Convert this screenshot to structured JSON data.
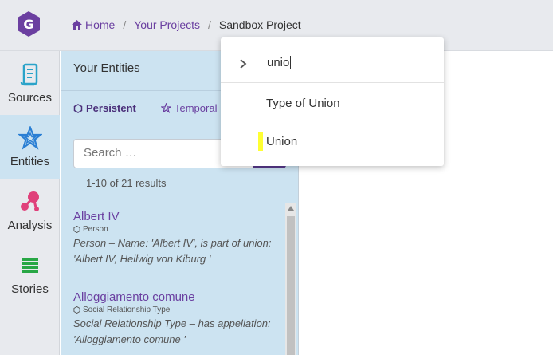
{
  "breadcrumb": {
    "home": "Home",
    "projects": "Your Projects",
    "current": "Sandbox Project"
  },
  "nav": [
    {
      "label": "Sources",
      "icon": "scroll-icon"
    },
    {
      "label": "Entities",
      "icon": "star-icon",
      "active": true
    },
    {
      "label": "Analysis",
      "icon": "network-icon"
    },
    {
      "label": "Stories",
      "icon": "lines-icon"
    }
  ],
  "panel": {
    "title": "Your Entities",
    "tab_persistent": "Persistent",
    "tab_temporal": "Temporal",
    "search_placeholder": "Search …",
    "results": "1-10 of 21 results"
  },
  "entities": [
    {
      "name": "Albert IV",
      "type": "Person",
      "desc1": "Person – Name: 'Albert IV', is part of union:",
      "desc2": "'Albert IV, Heilwig von Kiburg '"
    },
    {
      "name": "Alloggiamento comune",
      "type": "Social Relationship Type",
      "desc1": "Social Relationship Type – has appellation:",
      "desc2": "'Alloggiamento comune '"
    }
  ],
  "dropdown": {
    "input": "unio",
    "options": [
      "Type of Union",
      "Union"
    ]
  },
  "colors": {
    "accent": "#6a3fa0",
    "panel_bg": "#cce3f1",
    "rail_bg": "#e8eaee",
    "logo": "#6b3fa0",
    "highlight": "#ffff33"
  }
}
